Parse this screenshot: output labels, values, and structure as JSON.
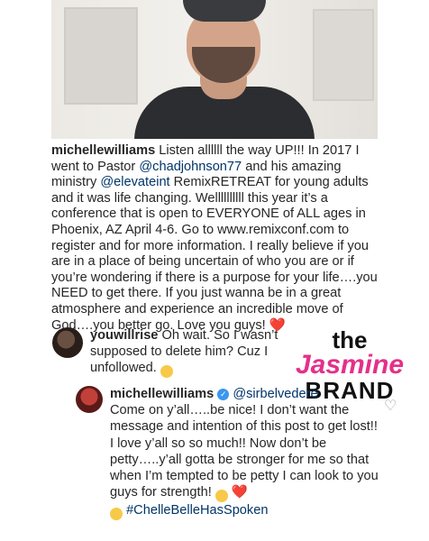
{
  "post": {
    "username": "michellewilliams",
    "caption_parts": [
      " Listen allllll the way UP!!! In 2017 I went to Pastor ",
      "@chadjohnson77",
      " and his amazing ministry ",
      "@elevateint",
      "  RemixRETREAT for young adults and it was life changing. Wellllllllll this year it’s a conference that is open to EVERYONE of ALL ages in Phoenix, AZ April 4-6. Go to www.remixconf.com to register and for more information. I really believe if you are in a place of being uncertain of who you are or if you’re wondering if there is a purpose for your life….you NEED to get there. If you just wanna be in a great atmosphere and experience an incredible move of God….you better go. Love you guys! ",
      "❤️"
    ]
  },
  "comments": [
    {
      "username": "youwillrise",
      "text": " Oh wait. So I wasn’t supposed to delete him? Cuz I unfollowed. "
    },
    {
      "username": "michellewilliams",
      "mention": "@sirbelvedere",
      "text": "Come on y’all…..be nice! I don’t want the message and intention  of this post to get lost!! I love y’all so so much!! Now don’t be petty…..y’all gotta be stronger for me so that when I’m tempted to be petty I can look to you guys for strength! ",
      "heart": "❤️",
      "hashtag": "#ChelleBelleHasSpoken"
    }
  ],
  "watermark": {
    "line1": "the",
    "line2": "Jasmine",
    "line3": "BRAND"
  },
  "icons": {
    "like": "♡"
  },
  "colors": {
    "mention": "#003569",
    "brand_pink": "#e4308a",
    "verified": "#3897f0"
  }
}
